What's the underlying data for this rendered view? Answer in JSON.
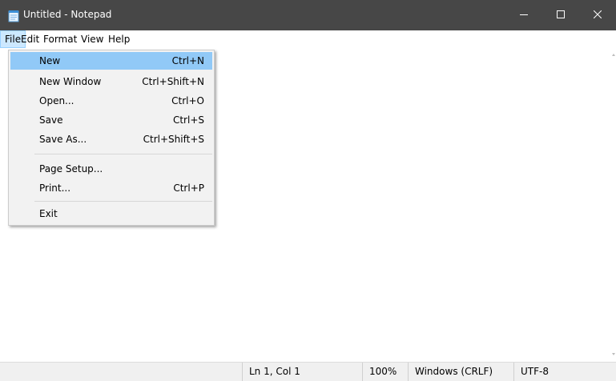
{
  "window": {
    "title": "Untitled - Notepad",
    "icon": "notepad-icon",
    "controls": [
      "minimize-icon",
      "maximize-icon",
      "close-icon"
    ]
  },
  "menubar": {
    "items": [
      {
        "label": "File",
        "active": true
      },
      {
        "label": "Edit"
      },
      {
        "label": "Format"
      },
      {
        "label": "View"
      },
      {
        "label": "Help"
      }
    ]
  },
  "file_menu": {
    "items": [
      {
        "label": "New",
        "shortcut": "Ctrl+N",
        "highlighted": true
      },
      {
        "label": "New Window",
        "shortcut": "Ctrl+Shift+N"
      },
      {
        "label": "Open...",
        "shortcut": "Ctrl+O"
      },
      {
        "label": "Save",
        "shortcut": "Ctrl+S"
      },
      {
        "label": "Save As...",
        "shortcut": "Ctrl+Shift+S"
      },
      {
        "label": "Page Setup...",
        "shortcut": ""
      },
      {
        "label": "Print...",
        "shortcut": "Ctrl+P"
      },
      {
        "label": "Exit",
        "shortcut": ""
      }
    ]
  },
  "editor": {
    "content": ""
  },
  "statusbar": {
    "position": "Ln 1, Col 1",
    "zoom": "100%",
    "line_ending": "Windows (CRLF)",
    "encoding": "UTF-8"
  },
  "colors": {
    "titlebar": "#474747",
    "menu_highlight": "#91c9f7",
    "menubar_active": "#cce8ff",
    "statusbar": "#f0f0f0"
  }
}
